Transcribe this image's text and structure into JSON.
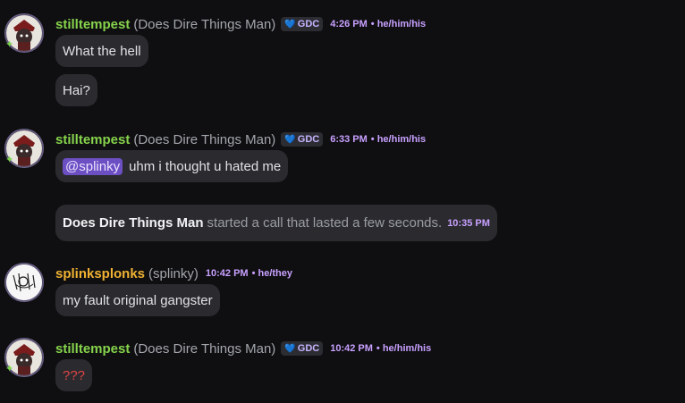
{
  "messages": [
    {
      "username": "stilltempest",
      "display_name": "(Does Dire Things Man)",
      "tag": "GDC",
      "time": "4:26 PM",
      "pronouns": "• he/him/his",
      "lines": [
        "What the hell",
        "Hai?"
      ]
    },
    {
      "username": "stilltempest",
      "display_name": "(Does Dire Things Man)",
      "tag": "GDC",
      "time": "6:33 PM",
      "pronouns": "• he/him/his",
      "mention": "@splinky",
      "text": "uhm i thought u hated me"
    },
    {
      "call_user": "Does Dire Things Man",
      "call_text": "started a call that lasted a few seconds.",
      "call_time": "10:35 PM"
    },
    {
      "username": "splinksplonks",
      "display_name": "(splinky)",
      "time": "10:42 PM",
      "pronouns": "• he/they",
      "text": "my fault original gangster"
    },
    {
      "username": "stilltempest",
      "display_name": "(Does Dire Things Man)",
      "tag": "GDC",
      "time": "10:42 PM",
      "pronouns": "• he/him/his",
      "text": "???"
    }
  ],
  "colors": {
    "background": "#0f0f11",
    "bubble": "#2b2b2f",
    "username_green": "#86d34c",
    "username_gold": "#f0b232",
    "timestamp": "#c8a0ff",
    "mention_bg": "#6d4fc4",
    "error_red": "#e04545"
  },
  "icons": [
    "avatar-stilltempest",
    "avatar-splinksplonks",
    "heart-icon",
    "star-badge-icon"
  ]
}
